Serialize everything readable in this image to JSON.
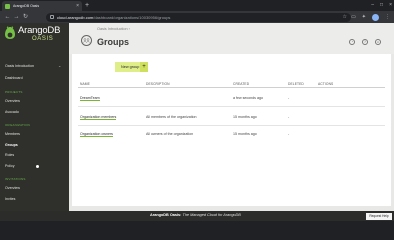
{
  "browser": {
    "tab_title": "ArangoDB Oasis",
    "url_domain": "cloud.arangodb.com",
    "url_path": "/dashboard/organizations/10030956/groups"
  },
  "logo": {
    "word": "ArangoDB",
    "sub": "OASIS"
  },
  "sidebar": {
    "org_intro": "Oasis Introduction",
    "dashboard": "Dashboard",
    "projects_section": "PROJECTS",
    "projects_items": [
      "Overview",
      "Avocado"
    ],
    "org_section": "ORGANIZATION",
    "org_items": [
      "Members",
      "Groups",
      "Roles",
      "Policy"
    ],
    "invites_section": "INVITATIONS",
    "invites_items": [
      "Overview",
      "Invites"
    ]
  },
  "header": {
    "breadcrumb": "Oasis Introduction",
    "breadcrumb_sep": "›",
    "title": "Groups"
  },
  "toolbar": {
    "new_group": "New group",
    "new_group_plus": "+"
  },
  "table": {
    "headers": [
      "NAME",
      "DESCRIPTION",
      "CREATED",
      "DELETED",
      "ACTIONS"
    ],
    "rows": [
      {
        "name": "DreamTeam",
        "description": "",
        "created": "a few seconds ago",
        "deleted": "-"
      },
      {
        "name": "Organization members",
        "description": "All members of the organization",
        "created": "15 months ago",
        "deleted": "-"
      },
      {
        "name": "Organization owners",
        "description": "All owners of the organization",
        "created": "15 months ago",
        "deleted": "-"
      }
    ]
  },
  "footer": {
    "brand": "ArangoDB Oasis:",
    "tagline": "The Managed Cloud for ArangoDB",
    "help": "Request Help"
  },
  "colors": {
    "accent": "#7ab534",
    "button": "#e0ee8a",
    "sidebar": "#2f302b"
  }
}
